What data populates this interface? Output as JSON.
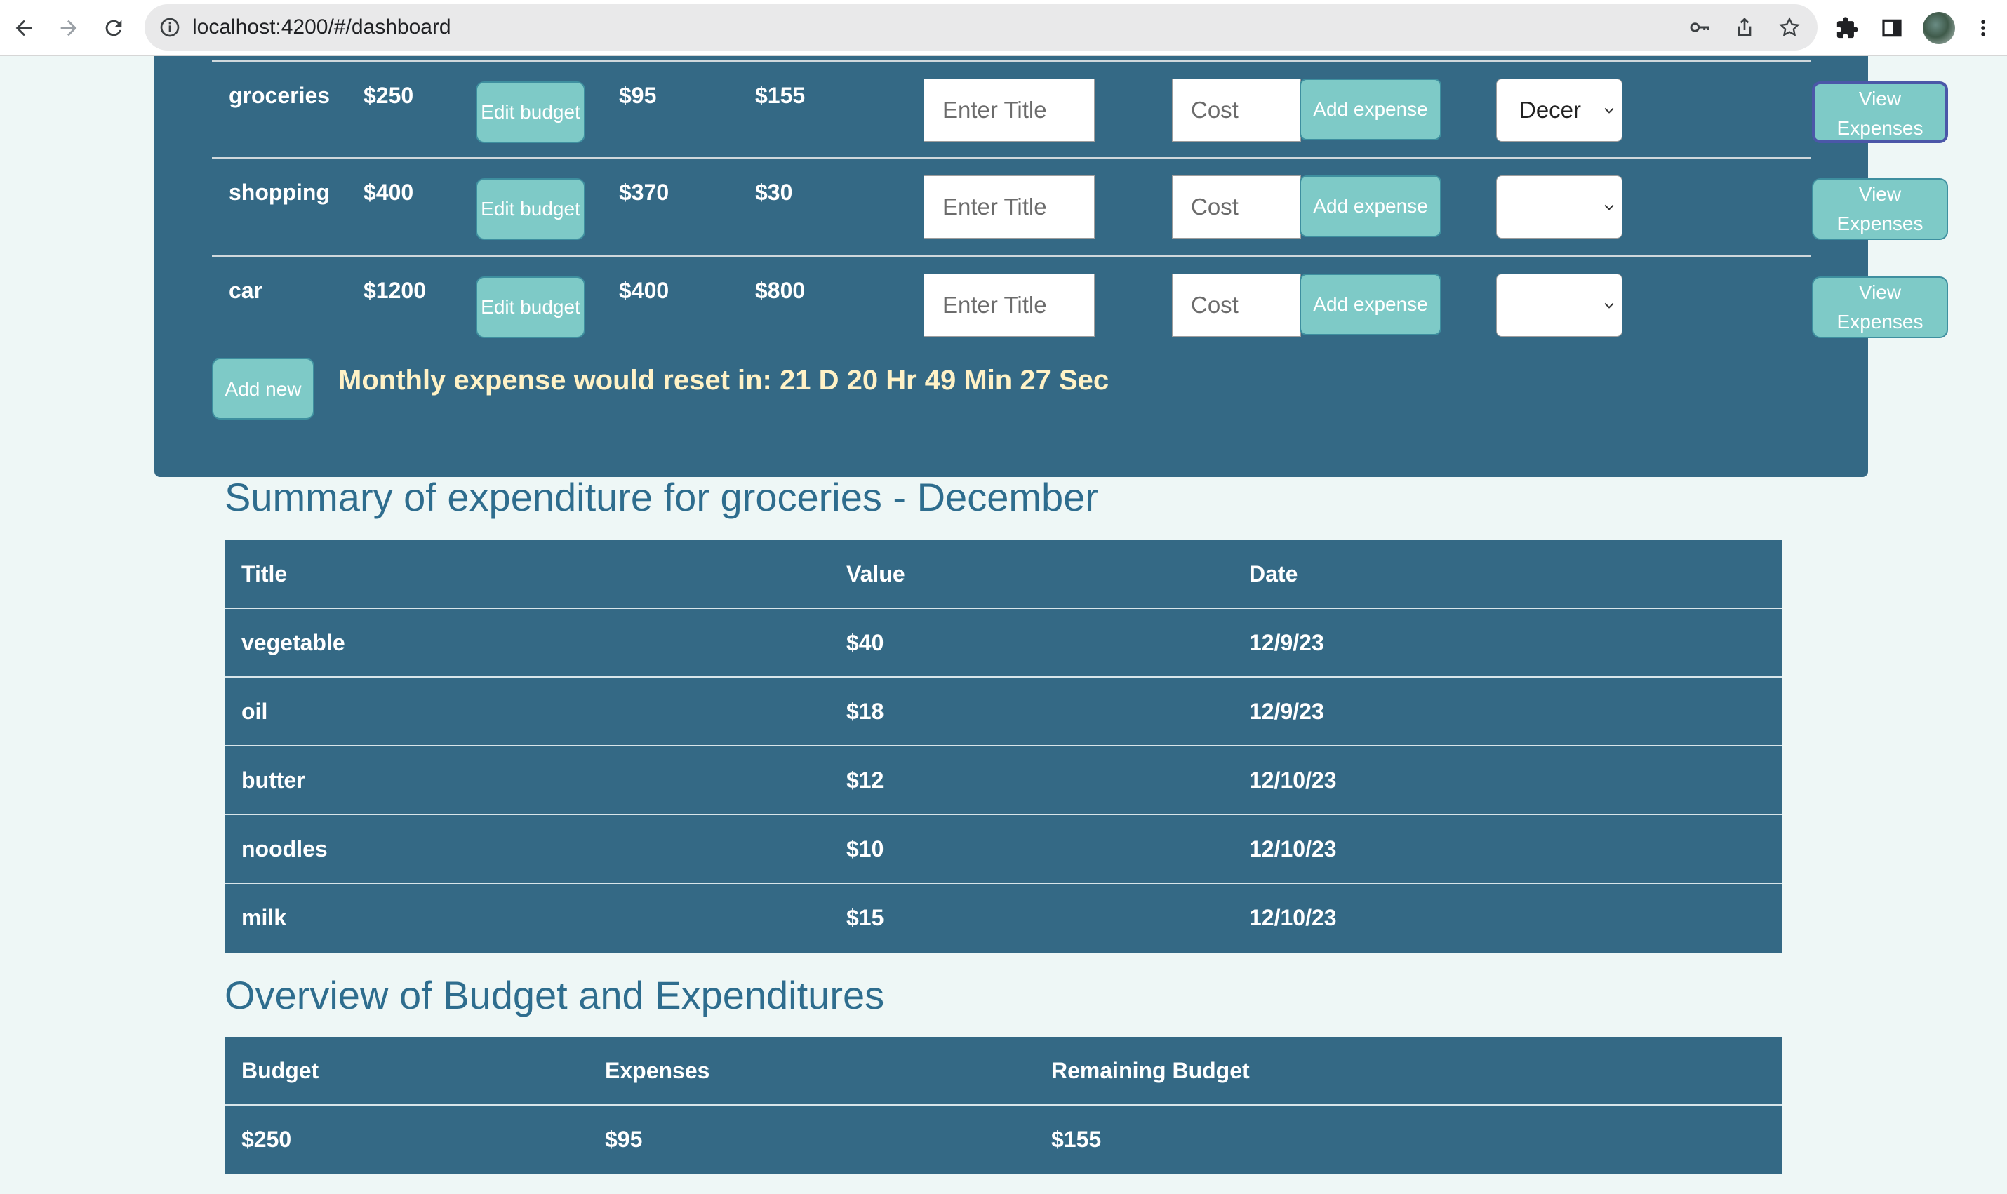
{
  "browser": {
    "url": "localhost:4200/#/dashboard"
  },
  "budgets": {
    "rows": [
      {
        "category": "groceries",
        "budget": "$250",
        "edit_label": "Edit budget",
        "expenses": "$95",
        "remaining": "$155",
        "title_placeholder": "Enter Title",
        "cost_placeholder": "Cost",
        "add_label": "Add expense",
        "month": "Decer",
        "view_label": "View Expenses"
      },
      {
        "category": "shopping",
        "budget": "$400",
        "edit_label": "Edit budget",
        "expenses": "$370",
        "remaining": "$30",
        "title_placeholder": "Enter Title",
        "cost_placeholder": "Cost",
        "add_label": "Add expense",
        "month": "",
        "view_label": "View Expenses"
      },
      {
        "category": "car",
        "budget": "$1200",
        "edit_label": "Edit budget",
        "expenses": "$400",
        "remaining": "$800",
        "title_placeholder": "Enter Title",
        "cost_placeholder": "Cost",
        "add_label": "Add expense",
        "month": "",
        "view_label": "View Expenses"
      }
    ],
    "add_new_label": "Add new",
    "reset_text": "Monthly expense would reset in: 21 D 20 Hr 49 Min 27 Sec"
  },
  "summary": {
    "title": "Summary of expenditure for groceries - December",
    "headers": [
      "Title",
      "Value",
      "Date"
    ],
    "rows": [
      [
        "vegetable",
        "$40",
        "12/9/23"
      ],
      [
        "oil",
        "$18",
        "12/9/23"
      ],
      [
        "butter",
        "$12",
        "12/10/23"
      ],
      [
        "noodles",
        "$10",
        "12/10/23"
      ],
      [
        "milk",
        "$15",
        "12/10/23"
      ]
    ]
  },
  "overview": {
    "title": "Overview of Budget and Expenditures",
    "headers": [
      "Budget",
      "Expenses",
      "Remaining Budget"
    ],
    "rows": [
      [
        "$250",
        "$95",
        "$155"
      ]
    ]
  },
  "colors": {
    "panel": "#346985",
    "button": "#7ecac7",
    "accent_text": "#fff2c6",
    "heading": "#2e6d8e",
    "page_bg": "#eef7f6"
  },
  "icons": [
    "back-arrow-icon",
    "forward-arrow-icon",
    "reload-icon",
    "info-icon",
    "key-icon",
    "share-icon",
    "star-icon",
    "puzzle-icon",
    "side-panel-icon",
    "menu-dots-icon",
    "chevron-down-icon"
  ]
}
